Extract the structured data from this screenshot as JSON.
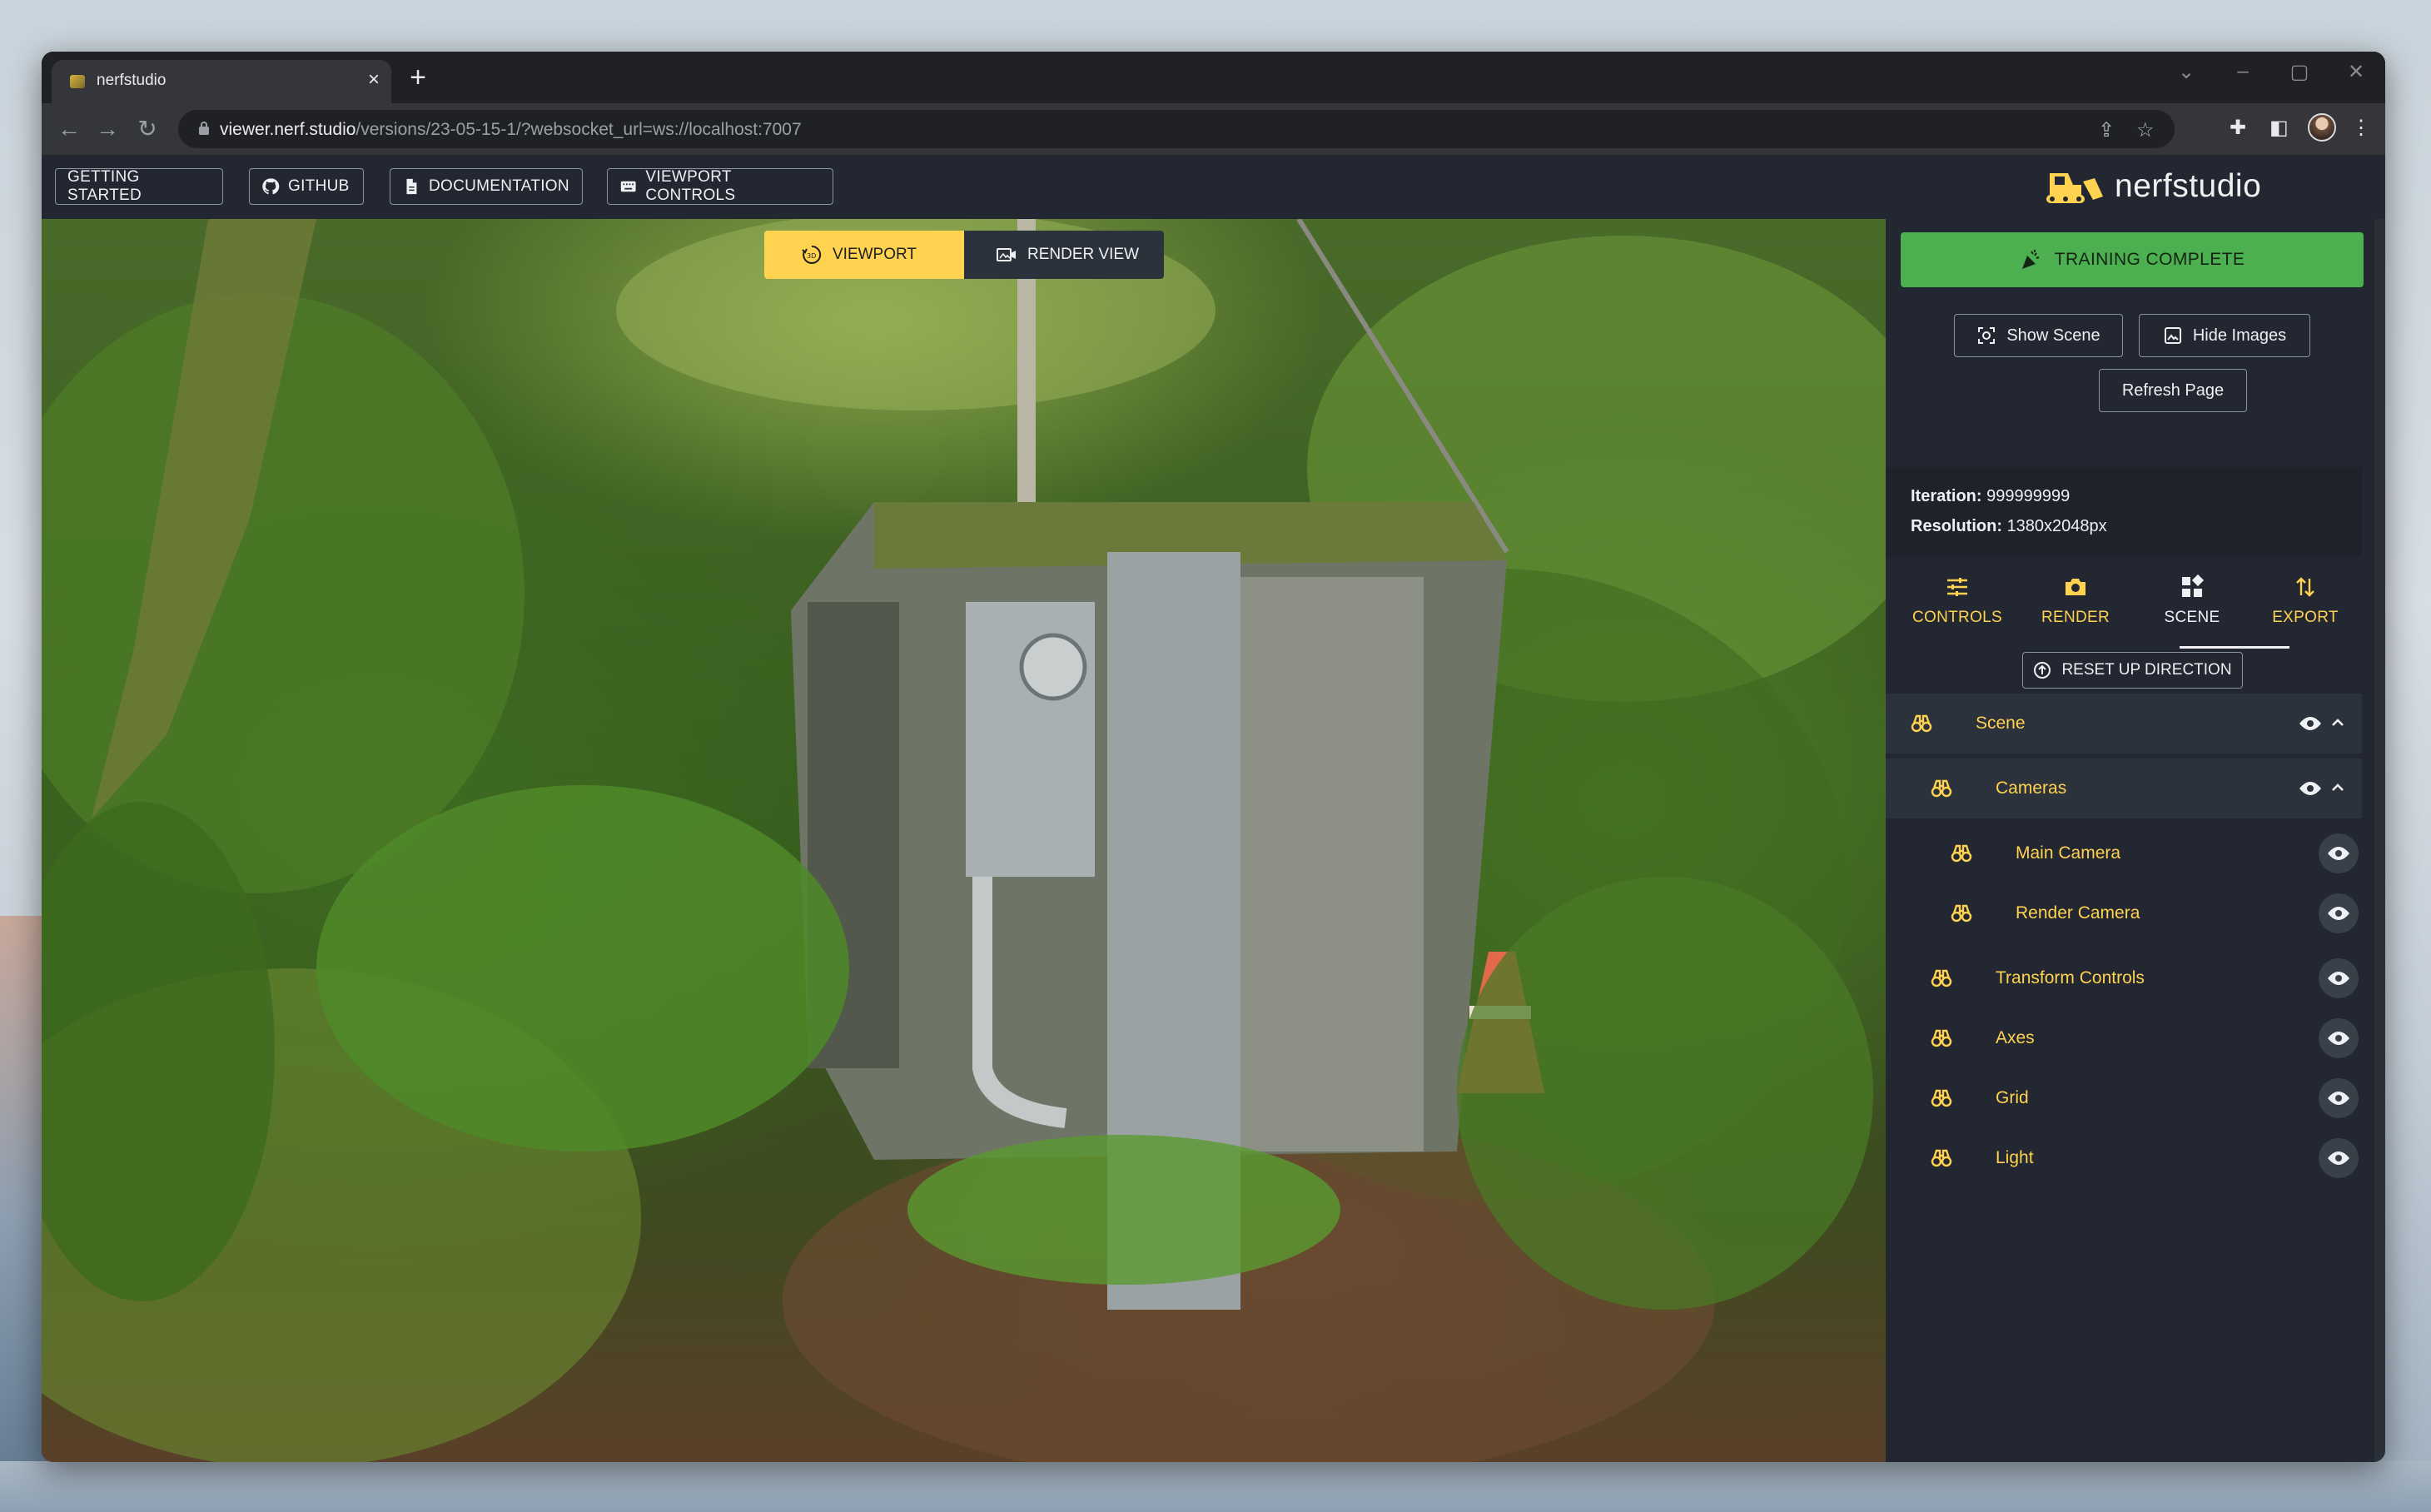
{
  "browser": {
    "tab_title": "nerfstudio",
    "url_host": "viewer.nerf.studio",
    "url_path": "/versions/23-05-15-1/?websocket_url=ws://localhost:7007"
  },
  "header": {
    "getting_started": "GETTING STARTED",
    "github": "GITHUB",
    "documentation": "DOCUMENTATION",
    "viewport_controls": "VIEWPORT CONTROLS",
    "logo_text": "nerfstudio"
  },
  "viewport": {
    "viewport_label": "VIEWPORT",
    "render_view_label": "RENDER VIEW",
    "active": "viewport"
  },
  "panel": {
    "training_status": "TRAINING COMPLETE",
    "show_scene": "Show Scene",
    "hide_images": "Hide Images",
    "refresh_page": "Refresh Page",
    "iteration_label": "Iteration:",
    "iteration_value": "999999999",
    "resolution_label": "Resolution:",
    "resolution_value": "1380x2048px",
    "tabs": [
      {
        "label": "CONTROLS",
        "icon": "sliders-icon"
      },
      {
        "label": "RENDER",
        "icon": "camera-icon"
      },
      {
        "label": "SCENE",
        "icon": "widgets-icon",
        "active": true
      },
      {
        "label": "EXPORT",
        "icon": "import-export-icon"
      }
    ],
    "reset_up_direction": "RESET UP DIRECTION",
    "scene_tree": [
      {
        "label": "Scene",
        "expanded": true
      },
      {
        "label": "Cameras",
        "expanded": true
      },
      {
        "label": "Main Camera"
      },
      {
        "label": "Render Camera"
      },
      {
        "label": "Transform Controls"
      },
      {
        "label": "Axes"
      },
      {
        "label": "Grid"
      },
      {
        "label": "Light"
      }
    ]
  },
  "colors": {
    "accent_yellow": "#ffd24f",
    "training_green": "#4caf50",
    "panel_bg": "#222731"
  }
}
